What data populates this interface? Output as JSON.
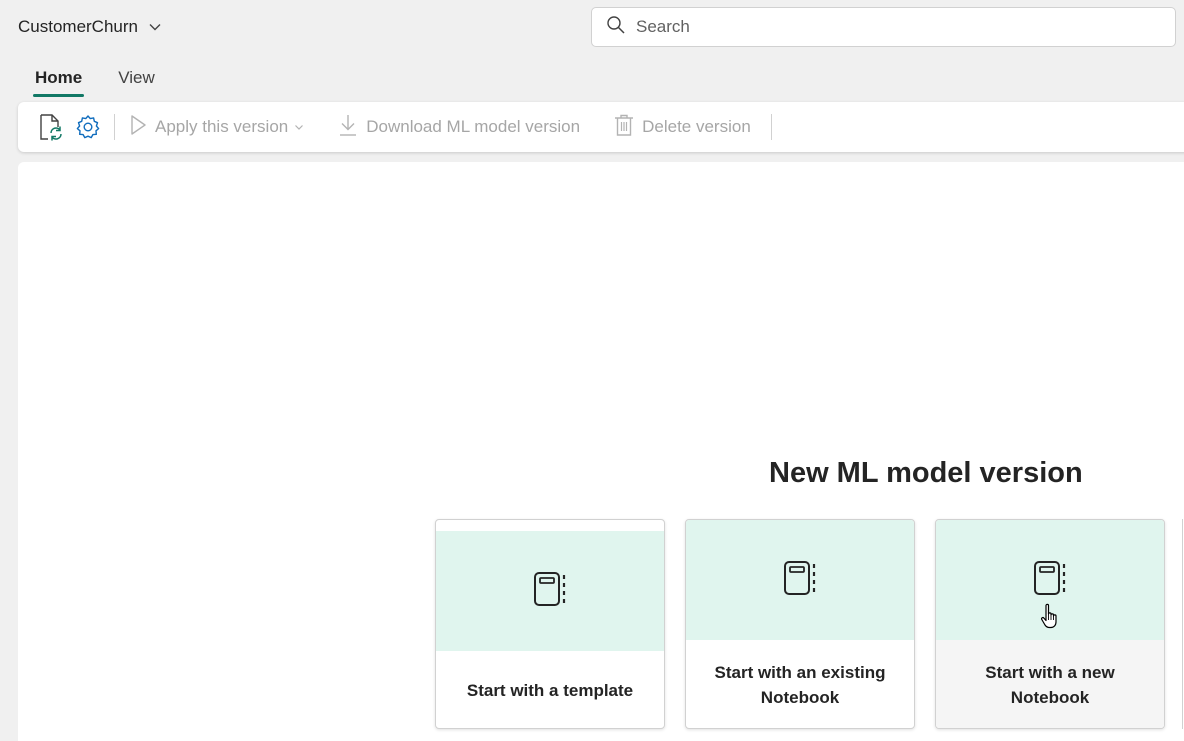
{
  "header": {
    "workspace_title": "CustomerChurn",
    "search_placeholder": "Search"
  },
  "tabs": [
    {
      "label": "Home",
      "active": true
    },
    {
      "label": "View",
      "active": false
    }
  ],
  "toolbar": {
    "apply_label": "Apply this version",
    "download_label": "Download ML model version",
    "delete_label": "Delete version"
  },
  "main": {
    "heading": "New ML model version",
    "cards": [
      {
        "label": "Start with a template"
      },
      {
        "label": "Start with an existing Notebook"
      },
      {
        "label": "Start with a new Notebook"
      }
    ]
  },
  "colors": {
    "accent": "#117865",
    "card_top": "#e0f5ee",
    "disabled_text": "#a6a6a6"
  },
  "icons": [
    "chevron-down-icon",
    "search-icon",
    "refresh-file-icon",
    "gear-icon",
    "play-icon",
    "download-icon",
    "trash-icon",
    "notebook-icon"
  ]
}
